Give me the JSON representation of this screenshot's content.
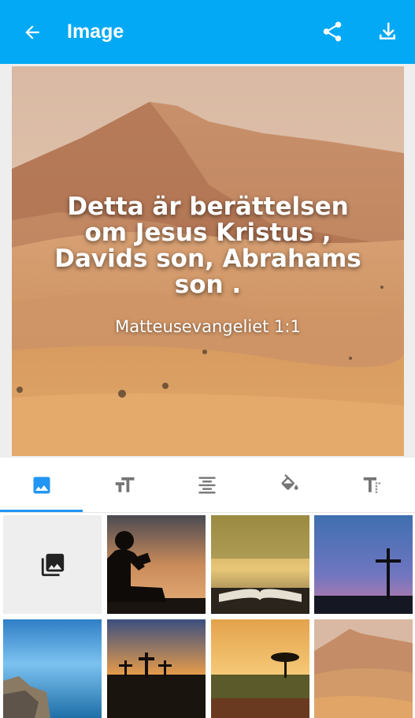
{
  "appbar": {
    "title": "Image",
    "back_icon": "arrow-back-icon",
    "share_icon": "share-icon",
    "download_icon": "download-icon",
    "color": "#03A9F4"
  },
  "preview": {
    "verse": "Detta är berättelsen om Jesus Kristus , Davids son, Abrahams son .",
    "reference": "Matteusevangeliet 1:1",
    "background": "desert dunes"
  },
  "tabs": {
    "items": [
      "image-tab-icon",
      "font-size-icon",
      "align-center-icon",
      "fill-color-icon",
      "text-format-icon"
    ],
    "selected": 0,
    "accent": "#2196F3"
  },
  "gallery": {
    "picker_icon": "photo-library-icon",
    "thumbnails": [
      "silhouette reading at sunset",
      "open book by lake",
      "cross on hill at dusk",
      "rocky sea shore",
      "three crosses at sunset",
      "tree on savanna at sunset",
      "desert dunes"
    ]
  }
}
